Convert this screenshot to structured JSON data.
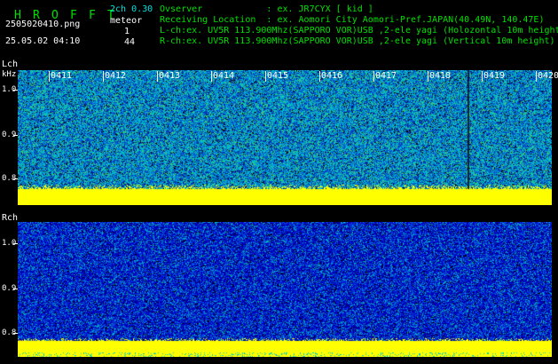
{
  "header": {
    "title_letters": [
      "H",
      "R",
      "O",
      "F",
      "F",
      "T"
    ],
    "filename": "2505020410.png",
    "datetime": "25.05.02 04:10",
    "channel_label": "2ch 0.30",
    "meteor_label": "meteor",
    "meteor_lch": "1",
    "meteor_rch": "44",
    "observer_line": "Ovserver            : ex. JR7CYX [ kid ]",
    "location_line": "Receiving Location  : ex. Aomori City Aomori-Pref.JAPAN(40.49N, 140.47E)",
    "lch_line": "L-ch:ex. UV5R 113.900Mhz(SAPPORO VOR)USB ,2-ele yagi (Holozontal 10m height)",
    "rch_line": "R-ch:ex. UV5R 113.900Mhz(SAPPORO VOR)USB ,2-ele yagi (Vertical 10m height)"
  },
  "lch": {
    "label": "Lch",
    "unit": "kHz",
    "ticks": [
      "1.0",
      "0.9",
      "0.8"
    ]
  },
  "rch": {
    "label": "Rch",
    "ticks": [
      "1.0",
      "0.9",
      "0.8"
    ]
  },
  "time_axis": [
    "0411",
    "0412",
    "0413",
    "0414",
    "0415",
    "0416",
    "0417",
    "0418",
    "0419",
    "0420"
  ],
  "colors": {
    "background": "#000000",
    "header_green": "#00e000",
    "noise_cyan": "#00c8c8",
    "noise_blue": "#0000c0",
    "baseline_yellow": "#ffff00"
  }
}
